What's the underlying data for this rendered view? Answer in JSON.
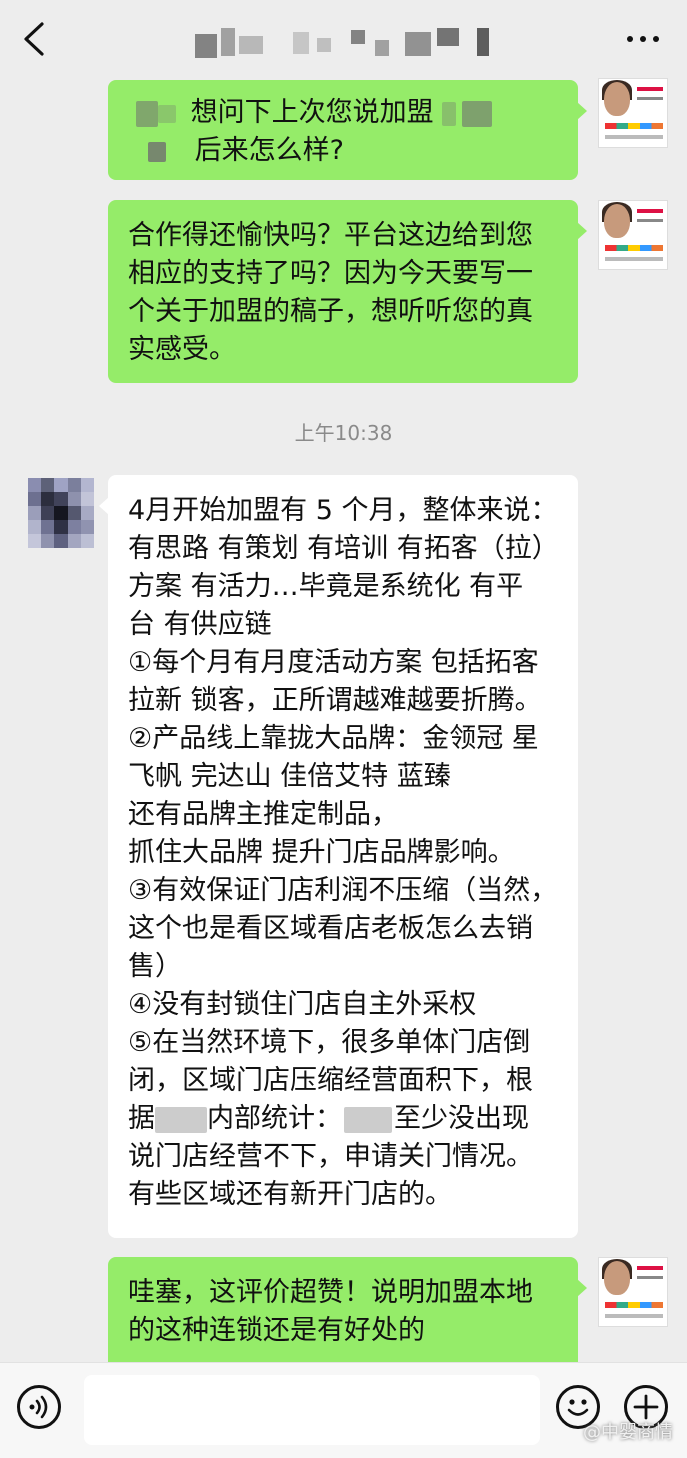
{
  "header": {
    "back_icon": "chevron-left-icon",
    "more_icon": "ellipsis-icon"
  },
  "messages": [
    {
      "side": "me",
      "lines": [
        "想问下上次您说加盟",
        "后来怎么样?"
      ]
    },
    {
      "side": "me",
      "lines": [
        "合作得还愉快吗？平台这边给到您",
        "相应的支持了吗？因为今天要写一",
        "个关于加盟的稿子，想听听您的真",
        "实感受。"
      ]
    },
    {
      "side": "other",
      "lines": [
        "4月开始加盟有 5 个月，整体来说：",
        "有思路 有策划 有培训 有拓客（拉）",
        "方案 有活力…毕竟是系统化 有平",
        "台 有供应链",
        "①每个月有月度活动方案 包括拓客",
        "拉新 锁客，正所谓越难越要折腾。",
        "②产品线上靠拢大品牌：金领冠 星",
        "飞帆 完达山 佳倍艾特 蓝臻",
        "还有品牌主推定制品，",
        "抓住大品牌 提升门店品牌影响。",
        "③有效保证门店利润不压缩（当然，",
        "这个也是看区域看店老板怎么去销",
        "售）",
        "④没有封锁住门店自主外采权",
        "⑤在当然环境下，很多单体门店倒",
        "闭，区域门店压缩经营面积下，根",
        "据",
        "内部统计：",
        "至少没出现",
        "说门店经营不下，申请关门情况。",
        "有些区域还有新开门店的。"
      ]
    },
    {
      "side": "me",
      "lines": [
        "哇塞，这评价超赞！说明加盟本地",
        "的这种连锁还是有好处的"
      ]
    }
  ],
  "timestamp": "上午10:38",
  "input_bar": {
    "voice_icon": "voice-icon",
    "emoji_icon": "emoji-icon",
    "plus_icon": "plus-icon",
    "placeholder": ""
  },
  "watermark": "@中婴商情",
  "colors": {
    "background": "#ededed",
    "my_bubble": "#95ec69",
    "their_bubble": "#ffffff"
  }
}
